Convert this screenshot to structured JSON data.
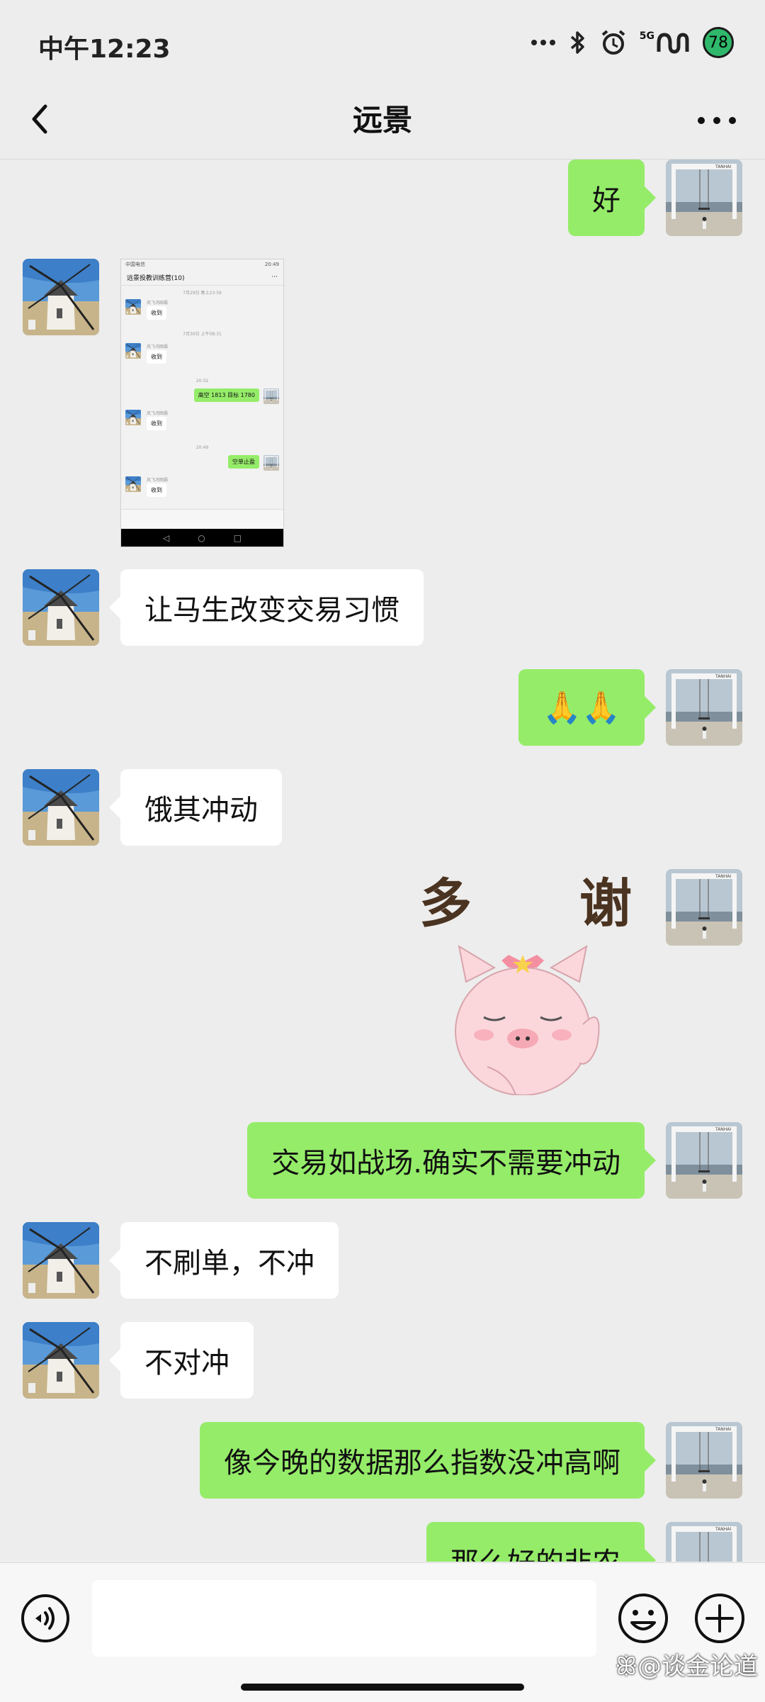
{
  "status_bar": {
    "time": "中午12:23",
    "network": "5G",
    "battery": "78"
  },
  "nav": {
    "title": "远景"
  },
  "messages": [
    {
      "side": "out",
      "type": "text",
      "text": "好"
    },
    {
      "side": "in",
      "type": "image"
    },
    {
      "side": "in",
      "type": "text",
      "text": "让马生改变交易习惯"
    },
    {
      "side": "out",
      "type": "text",
      "text": "🙏🙏"
    },
    {
      "side": "in",
      "type": "text",
      "text": "饿其冲动"
    },
    {
      "side": "out",
      "type": "sticker",
      "text": "多 谢"
    },
    {
      "side": "out",
      "type": "text",
      "text": "交易如战场.确实不需要冲动"
    },
    {
      "side": "in",
      "type": "text",
      "text": "不刷单，不冲"
    },
    {
      "side": "in",
      "type": "text",
      "text": "不对冲"
    },
    {
      "side": "out",
      "type": "text",
      "text": "像今晚的数据那么指数没冲高啊"
    },
    {
      "side": "out",
      "type": "text",
      "text": "那么好的非农"
    }
  ],
  "thumbnail": {
    "status_left": "中国电信",
    "status_right": "20:49",
    "title": "远景投教训练营(10)",
    "times": [
      "7月29日 晚上23:59",
      "7月30日 上午08:31",
      "20:32",
      "20:49"
    ],
    "sender": "风飞鸿图霸",
    "messages": [
      "收到",
      "收到",
      "高空 1813 目标 1780",
      "收到",
      "空单止盈",
      "收到"
    ]
  },
  "sticker": {
    "char_left": "多",
    "char_right": "谢"
  },
  "input_bar": {
    "placeholder": "",
    "watermark": "@谈金论道"
  },
  "colors": {
    "outgoing_bubble": "#95ec69",
    "incoming_bubble": "#ffffff",
    "background": "#ededed",
    "battery": "#2fb86b"
  },
  "icons": [
    "back-arrow-icon",
    "more-icon",
    "bluetooth-icon",
    "alarm-icon",
    "signal-icon",
    "voice-icon",
    "emoji-icon",
    "plus-icon",
    "weibo-icon"
  ]
}
